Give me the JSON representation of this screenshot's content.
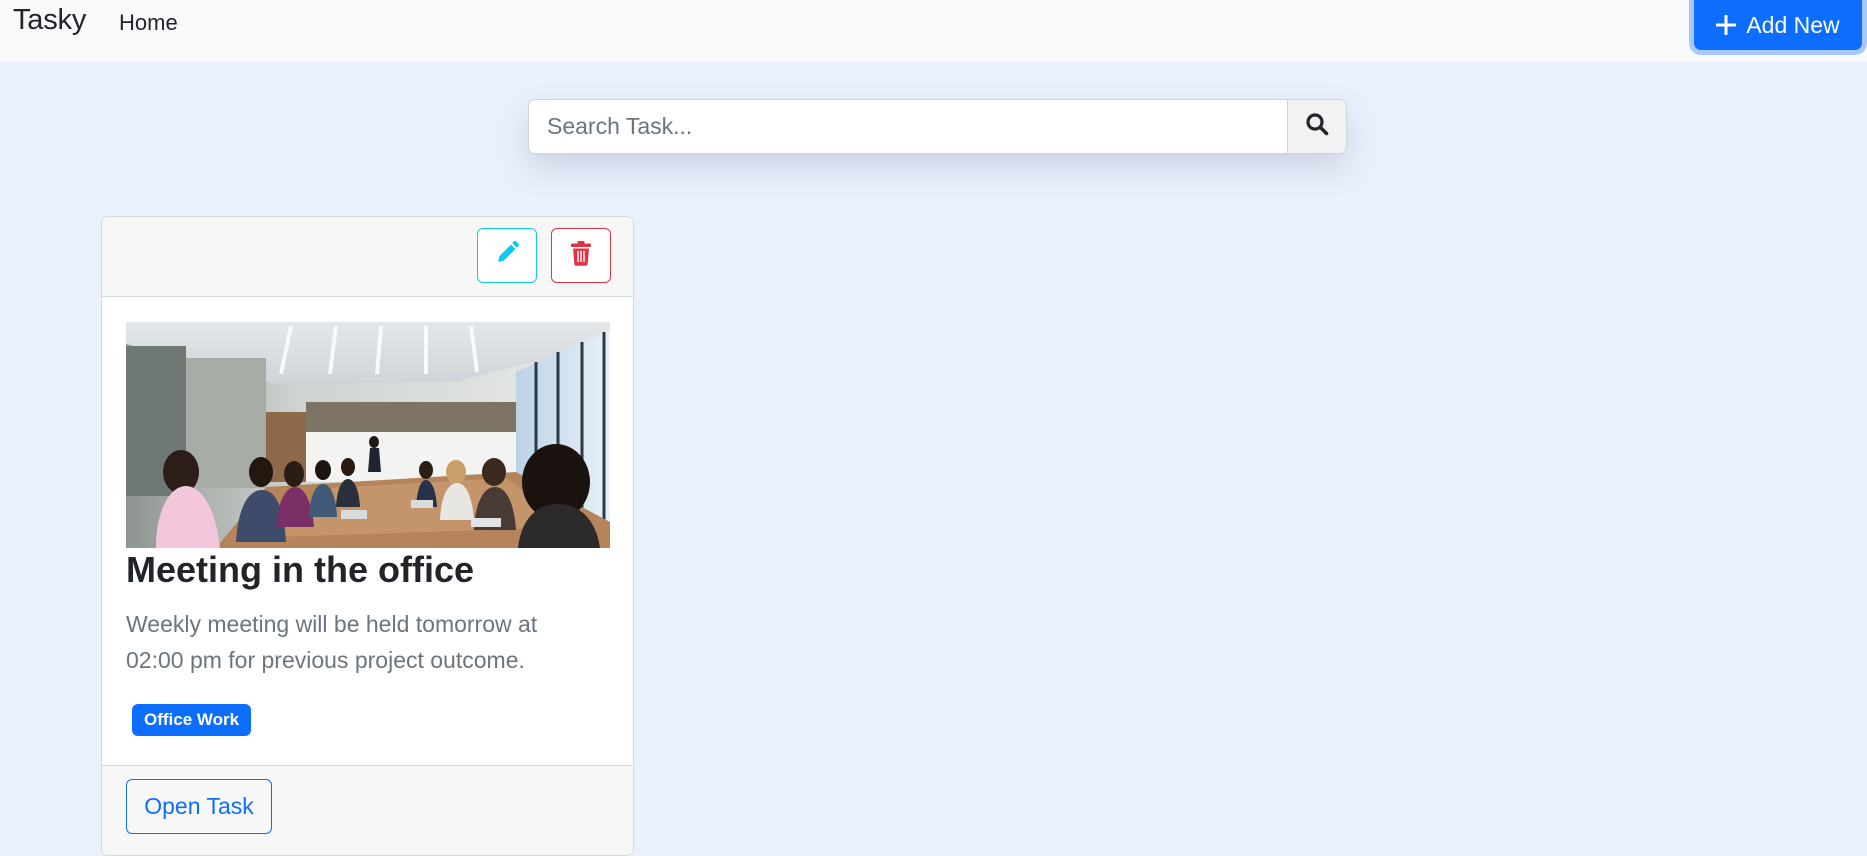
{
  "navbar": {
    "brand": "Tasky",
    "home_label": "Home",
    "add_button_label": "Add New"
  },
  "search": {
    "placeholder": "Search Task..."
  },
  "tasks": [
    {
      "image_description": "meeting-room-photo",
      "title": "Meeting in the office",
      "description": "Weekly meeting will be held tomorrow at 02:00 pm for previous project outcome.",
      "badge": "Office Work",
      "open_label": "Open Task"
    }
  ],
  "colors": {
    "page_bg": "#eaf0fc",
    "navbar_bg": "#f8f9fa",
    "primary": "#0d6efd",
    "info": "#0dcaf0",
    "danger": "#dc3545",
    "muted_text": "#6c757d"
  },
  "icons": {
    "add": "plus-icon",
    "search": "search-icon",
    "edit": "pencil-icon",
    "delete": "trash-icon"
  }
}
